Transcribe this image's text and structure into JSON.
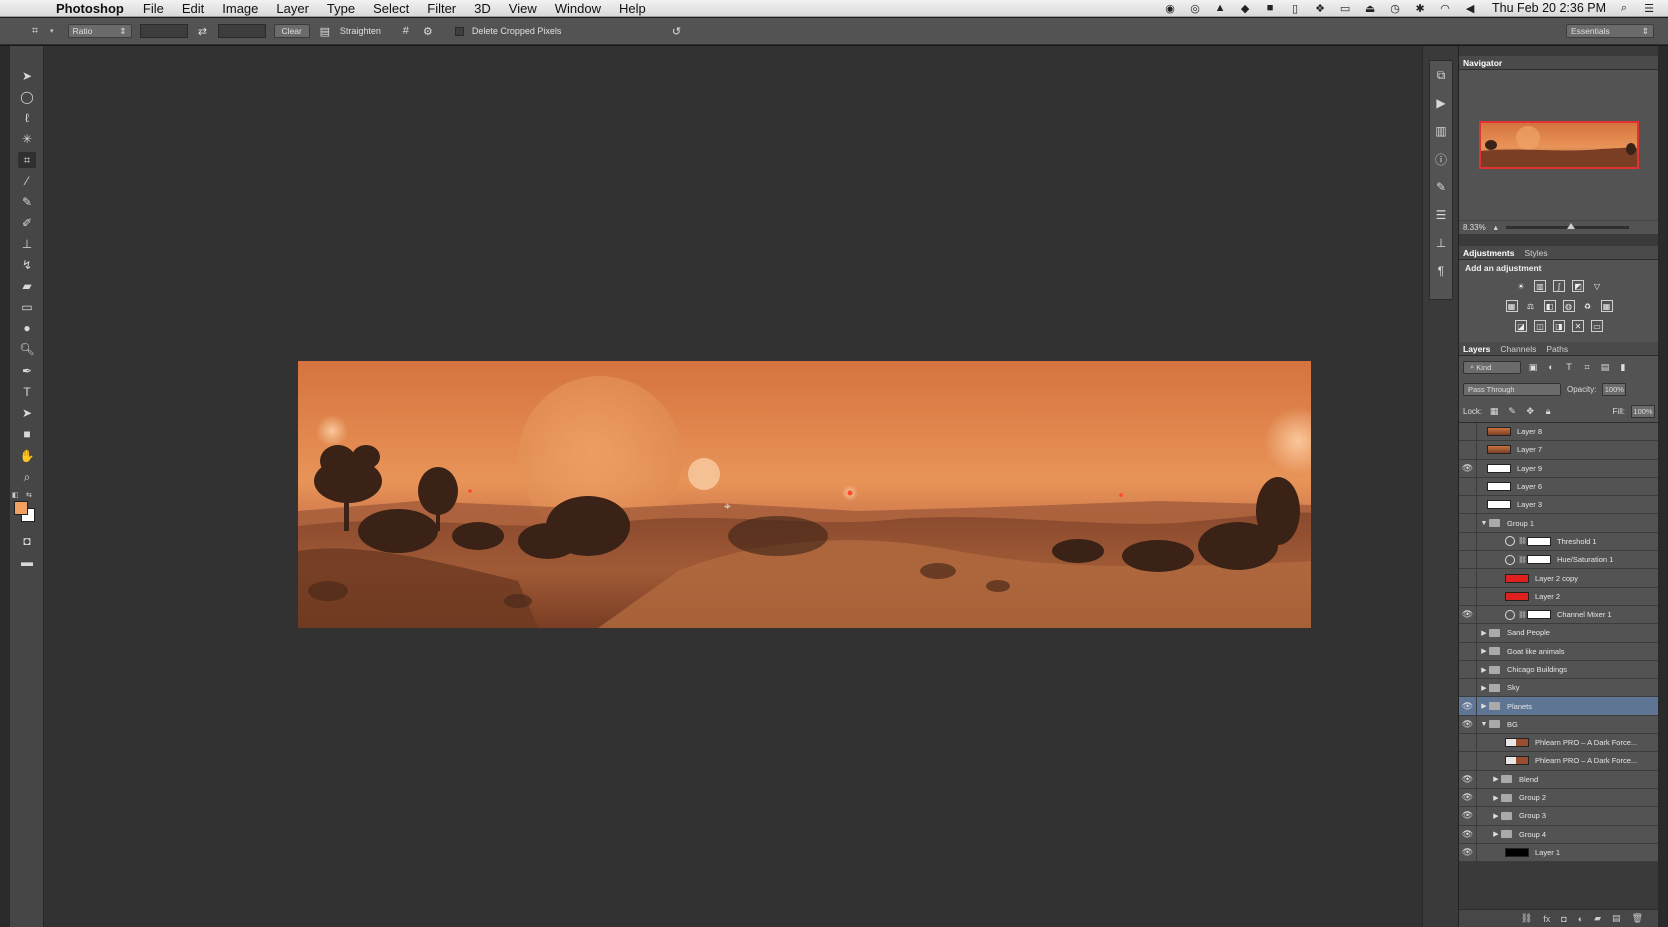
{
  "menubar": {
    "app_name": "Photoshop",
    "menus": [
      "File",
      "Edit",
      "Image",
      "Layer",
      "Type",
      "Select",
      "Filter",
      "3D",
      "View",
      "Window",
      "Help"
    ],
    "clock": "Thu Feb 20  2:36 PM"
  },
  "options_bar": {
    "ratio_select": "Ratio",
    "clear_label": "Clear",
    "straighten_label": "Straighten",
    "delete_cropped_label": "Delete Cropped Pixels",
    "workspace": "Essentials"
  },
  "navigator": {
    "title": "Navigator",
    "zoom": "8.33%"
  },
  "adjustments": {
    "tabs": [
      "Adjustments",
      "Styles"
    ],
    "heading": "Add an adjustment"
  },
  "layers_panel": {
    "tabs": [
      "Layers",
      "Channels",
      "Paths"
    ],
    "kind_label": "Kind",
    "blend_mode": "Pass Through",
    "opacity_label": "Opacity:",
    "opacity_value": "100%",
    "lock_label": "Lock:",
    "fill_label": "Fill:",
    "fill_value": "100%",
    "layers": [
      {
        "name": "Layer 8",
        "visible": false,
        "kind": "pixel",
        "indent": 0
      },
      {
        "name": "Layer 7",
        "visible": false,
        "kind": "pixel",
        "indent": 0
      },
      {
        "name": "Layer 9",
        "visible": true,
        "kind": "pixel",
        "indent": 0
      },
      {
        "name": "Layer 6",
        "visible": false,
        "kind": "pixel",
        "indent": 0
      },
      {
        "name": "Layer 3",
        "visible": false,
        "kind": "pixel",
        "indent": 0
      },
      {
        "name": "Group 1",
        "visible": false,
        "kind": "group-open",
        "indent": 0
      },
      {
        "name": "Threshold 1",
        "visible": false,
        "kind": "adjustment",
        "indent": 1
      },
      {
        "name": "Hue/Saturation 1",
        "visible": false,
        "kind": "adjustment",
        "indent": 1
      },
      {
        "name": "Layer 2 copy",
        "visible": false,
        "kind": "pixel",
        "indent": 1
      },
      {
        "name": "Layer 2",
        "visible": false,
        "kind": "pixel",
        "indent": 1
      },
      {
        "name": "Channel Mixer 1",
        "visible": true,
        "kind": "adjustment",
        "indent": 1
      },
      {
        "name": "Sand People",
        "visible": false,
        "kind": "group",
        "indent": 0
      },
      {
        "name": "Goat like animals",
        "visible": false,
        "kind": "group",
        "indent": 0
      },
      {
        "name": "Chicago Buildings",
        "visible": false,
        "kind": "group",
        "indent": 0
      },
      {
        "name": "Sky",
        "visible": false,
        "kind": "group",
        "indent": 0
      },
      {
        "name": "Planets",
        "visible": true,
        "kind": "group",
        "indent": 0,
        "selected": true
      },
      {
        "name": "BG",
        "visible": true,
        "kind": "group-open",
        "indent": 0
      },
      {
        "name": "Phlearn PRO – A Dark Force...",
        "visible": false,
        "kind": "pixel",
        "indent": 1
      },
      {
        "name": "Phlearn PRO – A Dark Force...",
        "visible": false,
        "kind": "pixel",
        "indent": 1
      },
      {
        "name": "Blend",
        "visible": true,
        "kind": "group",
        "indent": 1
      },
      {
        "name": "Group 2",
        "visible": true,
        "kind": "group",
        "indent": 1
      },
      {
        "name": "Group 3",
        "visible": true,
        "kind": "group",
        "indent": 1
      },
      {
        "name": "Group 4",
        "visible": true,
        "kind": "group",
        "indent": 1
      },
      {
        "name": "Layer 1",
        "visible": true,
        "kind": "pixel",
        "indent": 1
      }
    ]
  },
  "colors": {
    "foreground": "#f0a060",
    "background": "#ffffff",
    "selection": "#5f7594",
    "navigator_frame": "#e2322d"
  }
}
